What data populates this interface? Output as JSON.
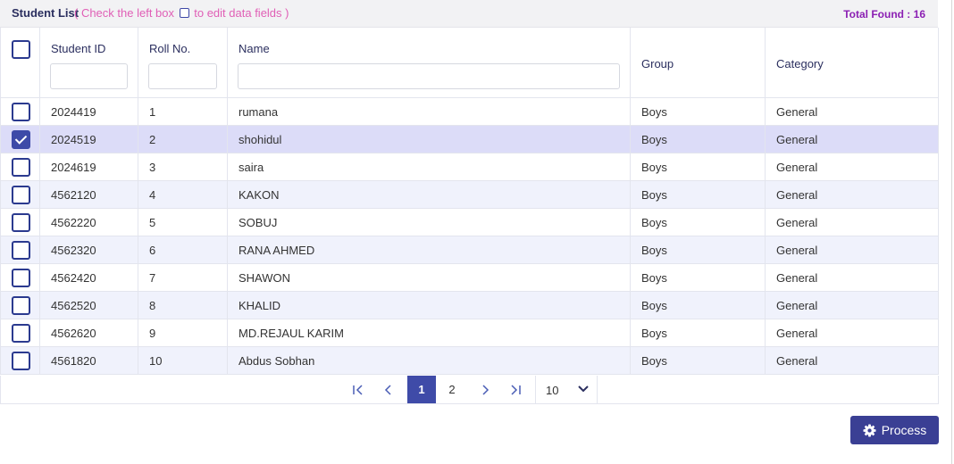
{
  "header": {
    "title": "Student List",
    "hint_prefix": "( Check the left box",
    "hint_suffix": "to edit data fields )",
    "total_found": "Total Found : 16"
  },
  "columns": {
    "student_id": "Student ID",
    "roll_no": "Roll No.",
    "name": "Name",
    "group": "Group",
    "category": "Category"
  },
  "filters": {
    "student_id": "",
    "roll_no": "",
    "name": ""
  },
  "rows": [
    {
      "checked": false,
      "student_id": "2024419",
      "roll": "1",
      "name": "rumana",
      "group": "Boys",
      "category": "General"
    },
    {
      "checked": true,
      "student_id": "2024519",
      "roll": "2",
      "name": "shohidul",
      "group": "Boys",
      "category": "General"
    },
    {
      "checked": false,
      "student_id": "2024619",
      "roll": "3",
      "name": "saira",
      "group": "Boys",
      "category": "General"
    },
    {
      "checked": false,
      "student_id": "4562120",
      "roll": "4",
      "name": "KAKON",
      "group": "Boys",
      "category": "General"
    },
    {
      "checked": false,
      "student_id": "4562220",
      "roll": "5",
      "name": "SOBUJ",
      "group": "Boys",
      "category": "General"
    },
    {
      "checked": false,
      "student_id": "4562320",
      "roll": "6",
      "name": "RANA AHMED",
      "group": "Boys",
      "category": "General"
    },
    {
      "checked": false,
      "student_id": "4562420",
      "roll": "7",
      "name": "SHAWON",
      "group": "Boys",
      "category": "General"
    },
    {
      "checked": false,
      "student_id": "4562520",
      "roll": "8",
      "name": "KHALID",
      "group": "Boys",
      "category": "General"
    },
    {
      "checked": false,
      "student_id": "4562620",
      "roll": "9",
      "name": "MD.REJAUL KARIM",
      "group": "Boys",
      "category": "General"
    },
    {
      "checked": false,
      "student_id": "4561820",
      "roll": "10",
      "name": "Abdus Sobhan",
      "group": "Boys",
      "category": "General"
    }
  ],
  "pagination": {
    "pages": [
      "1",
      "2"
    ],
    "current": "1",
    "page_size": "10",
    "icons": {
      "first": "first-page-icon",
      "prev": "chevron-left-icon",
      "next": "chevron-right-icon",
      "last": "last-page-icon",
      "dropdown": "chevron-down-icon"
    }
  },
  "process_button": {
    "label": "Process",
    "icon": "gear-icon"
  },
  "colors": {
    "accent": "#3f4ba8",
    "button": "#3a3f94",
    "hint": "#e05fb6",
    "total": "#8b1fb3",
    "selected_row": "#dcdcf8",
    "alt_row": "#f0f2fc"
  }
}
